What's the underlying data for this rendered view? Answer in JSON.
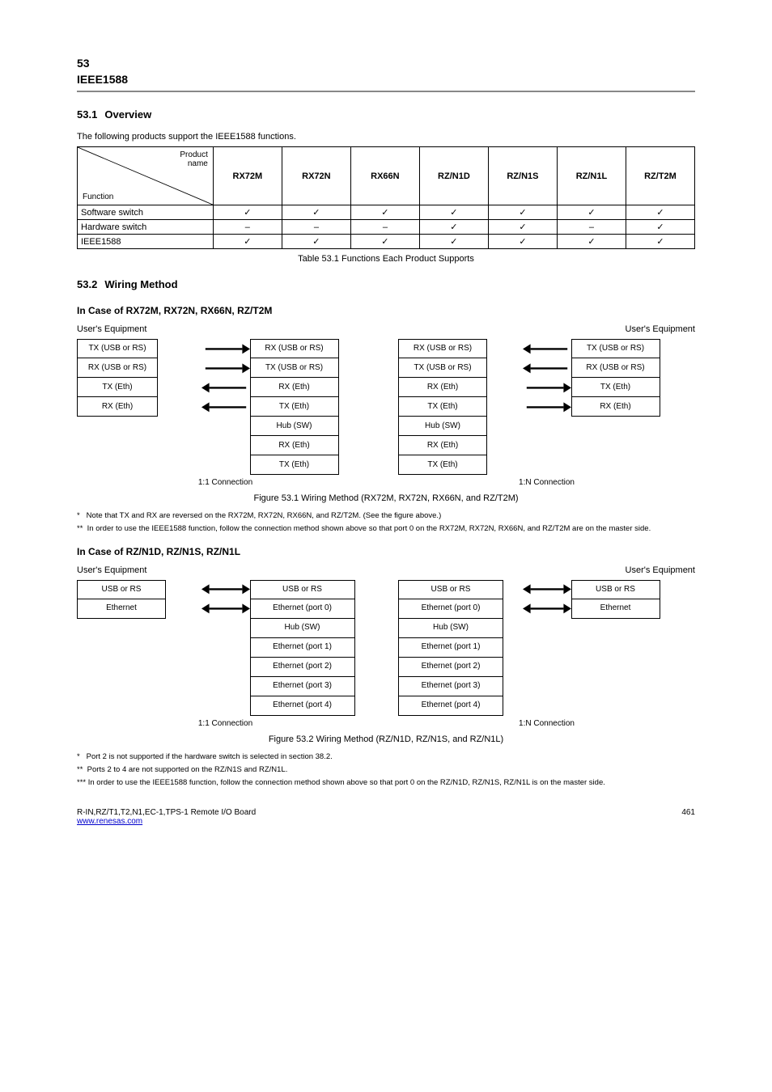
{
  "header": {
    "section_num": "53",
    "section_title": "IEEE1588"
  },
  "intro": {
    "num": "53.1",
    "title": "Overview",
    "text": "The following products support the IEEE1588 functions."
  },
  "table1": {
    "diag_top": "Product\nname",
    "diag_bottom": "Function",
    "cols": [
      "RX72M",
      "RX72N",
      "RX66N",
      "RZ/N1D",
      "RZ/N1S",
      "RZ/N1L",
      "RZ/T2M"
    ],
    "rows": [
      {
        "label": "Software switch",
        "cells": [
          "✓",
          "✓",
          "✓",
          "✓",
          "✓",
          "✓",
          "✓"
        ]
      },
      {
        "label": "Hardware switch",
        "cells": [
          "–",
          "–",
          "–",
          "✓",
          "✓",
          "–",
          "✓"
        ]
      },
      {
        "label": "IEEE1588",
        "cells": [
          "✓",
          "✓",
          "✓",
          "✓",
          "✓",
          "✓",
          "✓"
        ]
      }
    ],
    "caption": "Table 53.1  Functions Each Product Supports"
  },
  "wiring": {
    "num": "53.2",
    "title": "Wiring Method",
    "sec1_title": "In Case of RX72M, RX72N, RX66N, RZ/T2M",
    "rx_left": {
      "eq": "User's Equipment",
      "left_pins": [
        "TX (USB or RS)",
        "RX (USB or RS)",
        "TX (Eth) ",
        "RX (Eth)"
      ],
      "right_pins": [
        "RX (USB or RS)",
        "TX (USB or RS)",
        "RX (Eth) ",
        "TX (Eth) ",
        "Hub (SW)",
        "RX (Eth)",
        "TX (Eth)"
      ],
      "arrows": [
        "right",
        "right",
        "left",
        "left"
      ]
    },
    "rx_right": {
      "eq": "User's Equipment",
      "left_pins": [
        "RX (USB or RS)",
        "TX (USB or RS)",
        "RX (Eth) ",
        "TX (Eth) ",
        "Hub (SW)",
        "RX (Eth)",
        "TX (Eth)"
      ],
      "right_pins": [
        "TX (USB or RS)",
        "RX (USB or RS)",
        "TX (Eth) ",
        "RX (Eth)"
      ],
      "arrows": [
        "left",
        "left",
        "right",
        "right"
      ]
    },
    "sub_cap_connect_1_1": "1:1 Connection",
    "sub_cap_connect_1_n": "1:N Connection",
    "mid_caption": "Figure 53.1  Wiring Method (RX72M, RX72N, RX66N, and RZ/T2M)",
    "note_star1": "*   Note that TX and RX are reversed on the RX72M, RX72N, RX66N, and RZ/T2M. (See the figure above.)",
    "note_star2": "**  In order to use the IEEE1588 function, follow the connection method shown above so that port 0  on the RX72M, RX72N, RX66N, and RZ/T2M are on the master side."
  },
  "wiring2": {
    "title": "In Case of RZ/N1D, RZ/N1S, RZ/N1L",
    "rz_left": {
      "eq": "User's Equipment",
      "left_pins": [
        "USB or RS",
        "Ethernet"
      ],
      "right_pins": [
        "USB or RS",
        "Ethernet (port 0)",
        "Hub (SW)",
        "Ethernet (port 1)",
        "Ethernet (port 2)",
        "Ethernet (port 3)",
        "Ethernet (port 4)"
      ],
      "arrows": [
        "both",
        "both"
      ]
    },
    "rz_right": {
      "eq": "User's Equipment",
      "left_pins": [
        "USB or RS",
        "Ethernet (port 0)",
        "Hub (SW)",
        "Ethernet (port 1)",
        "Ethernet (port 2)",
        "Ethernet (port 3)",
        "Ethernet (port 4)"
      ],
      "right_pins": [
        "USB or RS",
        "Ethernet"
      ],
      "arrows": [
        "both",
        "both"
      ]
    },
    "sub_cap_left": "1:1 Connection",
    "sub_cap_right": "1:N Connection",
    "caption": "Figure 53.2  Wiring Method (RZ/N1D, RZ/N1S, and RZ/N1L)",
    "note_star1": "*   Port 2 is not supported if the hardware switch is selected in section 38.2.",
    "note_star2": "**  Ports 2 to 4 are not supported on the RZ/N1S and RZ/N1L.",
    "note_star3": "*** In order to use the IEEE1588 function, follow the connection method shown above so that port 0 on the RZ/N1D, RZ/N1S, RZ/N1L is on the master side."
  },
  "footer": {
    "doc": "R-IN,RZ/T1,T2,N1,EC-1,TPS-1 Remote I/O Board",
    "link": "www.renesas.com",
    "page": "461"
  }
}
